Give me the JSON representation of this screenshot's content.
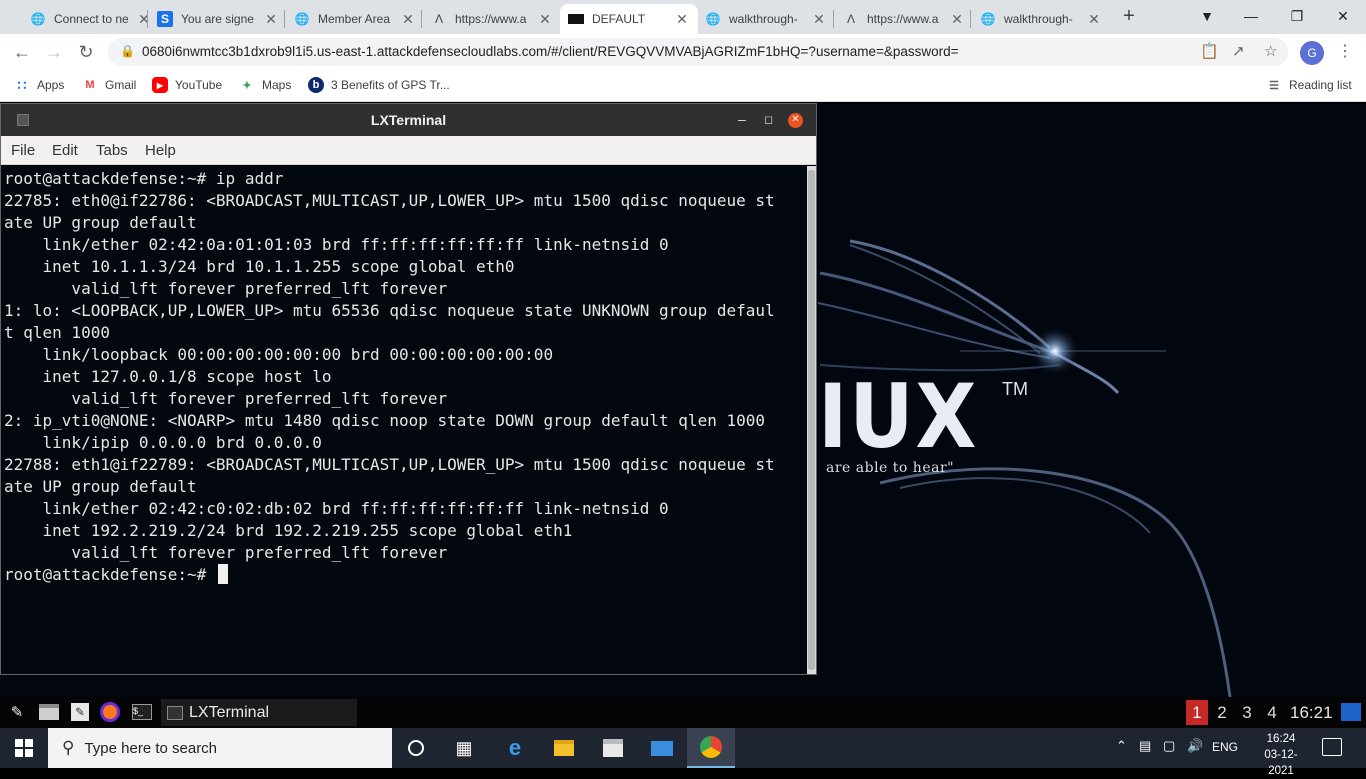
{
  "browser": {
    "tabs": [
      {
        "title": "Connect to ne",
        "icon": "globe-icon",
        "active": false
      },
      {
        "title": "You are signe",
        "icon": "s-icon",
        "active": false
      },
      {
        "title": "Member Area",
        "icon": "globe-icon",
        "active": false
      },
      {
        "title": "https://www.a",
        "icon": "a-icon",
        "active": false
      },
      {
        "title": "DEFAULT",
        "icon": "terminal-icon",
        "active": true
      },
      {
        "title": "walkthrough-",
        "icon": "globe-icon",
        "active": false
      },
      {
        "title": "https://www.a",
        "icon": "a-icon",
        "active": false
      },
      {
        "title": "walkthrough-",
        "icon": "globe-icon",
        "active": false
      }
    ],
    "new_tab": "+",
    "url": "0680i6nwmtcc3b1dxrob9l1i5.us-east-1.attackdefensecloudlabs.com/#/client/REVGQVVMVABjAGRIZmF1bHQ=?username=&password=",
    "profile_initial": "G",
    "bookmarks": [
      {
        "label": "Apps",
        "icon": "apps-grid-icon"
      },
      {
        "label": "Gmail",
        "icon": "gmail-icon"
      },
      {
        "label": "YouTube",
        "icon": "youtube-icon"
      },
      {
        "label": "Maps",
        "icon": "maps-icon"
      },
      {
        "label": "3 Benefits of GPS Tr...",
        "icon": "b-icon"
      }
    ],
    "reading_list": "Reading list"
  },
  "desktop": {
    "wallpaper_text": "IUX",
    "wallpaper_tm": "TM",
    "wallpaper_quote": "are able to hear\""
  },
  "terminal": {
    "title": "LXTerminal",
    "menu": [
      "File",
      "Edit",
      "Tabs",
      "Help"
    ],
    "lines": [
      "root@attackdefense:~# ip addr",
      "22785: eth0@if22786: <BROADCAST,MULTICAST,UP,LOWER_UP> mtu 1500 qdisc noqueue st",
      "ate UP group default",
      "    link/ether 02:42:0a:01:01:03 brd ff:ff:ff:ff:ff:ff link-netnsid 0",
      "    inet 10.1.1.3/24 brd 10.1.1.255 scope global eth0",
      "       valid_lft forever preferred_lft forever",
      "1: lo: <LOOPBACK,UP,LOWER_UP> mtu 65536 qdisc noqueue state UNKNOWN group defaul",
      "t qlen 1000",
      "    link/loopback 00:00:00:00:00:00 brd 00:00:00:00:00:00",
      "    inet 127.0.0.1/8 scope host lo",
      "       valid_lft forever preferred_lft forever",
      "2: ip_vti0@NONE: <NOARP> mtu 1480 qdisc noop state DOWN group default qlen 1000",
      "    link/ipip 0.0.0.0 brd 0.0.0.0",
      "22788: eth1@if22789: <BROADCAST,MULTICAST,UP,LOWER_UP> mtu 1500 qdisc noqueue st",
      "ate UP group default",
      "    link/ether 02:42:c0:02:db:02 brd ff:ff:ff:ff:ff:ff link-netnsid 0",
      "    inet 192.2.219.2/24 brd 192.2.219.255 scope global eth1",
      "       valid_lft forever preferred_lft forever"
    ],
    "prompt": "root@attackdefense:~# "
  },
  "lxpanel": {
    "task_label": "LXTerminal",
    "workspaces": [
      "1",
      "2",
      "3",
      "4"
    ],
    "active_workspace": "1",
    "clock": "16:21"
  },
  "windows": {
    "search_placeholder": "Type here to search",
    "language": "ENG",
    "time": "16:24",
    "date": "03-12-2021"
  }
}
